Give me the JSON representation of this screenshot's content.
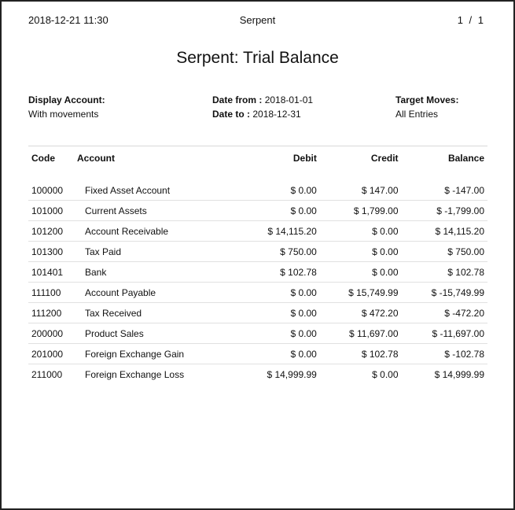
{
  "header": {
    "datetime": "2018-12-21 11:30",
    "company": "Serpent",
    "page_indicator": "1 / 1"
  },
  "title": "Serpent: Trial Balance",
  "info": {
    "display_account_label": "Display Account:",
    "display_account_value": "With movements",
    "date_from_label": "Date from :",
    "date_from_value": "2018-01-01",
    "date_to_label": "Date to :",
    "date_to_value": "2018-12-31",
    "target_moves_label": "Target Moves:",
    "target_moves_value": "All Entries"
  },
  "table": {
    "columns": [
      "Code",
      "Account",
      "Debit",
      "Credit",
      "Balance"
    ],
    "rows": [
      {
        "code": "100000",
        "account": "Fixed Asset Account",
        "debit": "$ 0.00",
        "credit": "$ 147.00",
        "balance": "$ -147.00"
      },
      {
        "code": "101000",
        "account": "Current Assets",
        "debit": "$ 0.00",
        "credit": "$ 1,799.00",
        "balance": "$ -1,799.00"
      },
      {
        "code": "101200",
        "account": "Account Receivable",
        "debit": "$ 14,115.20",
        "credit": "$ 0.00",
        "balance": "$ 14,115.20"
      },
      {
        "code": "101300",
        "account": "Tax Paid",
        "debit": "$ 750.00",
        "credit": "$ 0.00",
        "balance": "$ 750.00"
      },
      {
        "code": "101401",
        "account": "Bank",
        "debit": "$ 102.78",
        "credit": "$ 0.00",
        "balance": "$ 102.78"
      },
      {
        "code": "111100",
        "account": "Account Payable",
        "debit": "$ 0.00",
        "credit": "$ 15,749.99",
        "balance": "$ -15,749.99"
      },
      {
        "code": "111200",
        "account": "Tax Received",
        "debit": "$ 0.00",
        "credit": "$ 472.20",
        "balance": "$ -472.20"
      },
      {
        "code": "200000",
        "account": "Product Sales",
        "debit": "$ 0.00",
        "credit": "$ 11,697.00",
        "balance": "$ -11,697.00"
      },
      {
        "code": "201000",
        "account": "Foreign Exchange Gain",
        "debit": "$ 0.00",
        "credit": "$ 102.78",
        "balance": "$ -102.78"
      },
      {
        "code": "211000",
        "account": "Foreign Exchange Loss",
        "debit": "$ 14,999.99",
        "credit": "$ 0.00",
        "balance": "$ 14,999.99"
      }
    ]
  }
}
